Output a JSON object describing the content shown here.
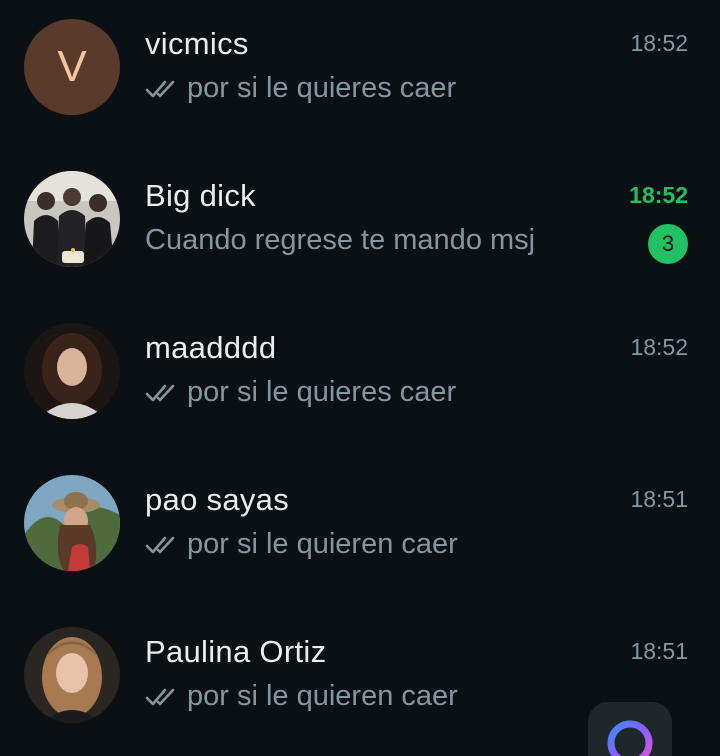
{
  "chats": [
    {
      "name": "vicmics",
      "time": "18:52",
      "preview": "por si le quieres caer",
      "avatar_letter": "V",
      "read_receipt": "double-check-icon"
    },
    {
      "name": "Big dick",
      "time": "18:52",
      "preview": "Cuando regrese te mando msj",
      "unread_count": "3"
    },
    {
      "name": "maadddd",
      "time": "18:52",
      "preview": "por si le quieres caer",
      "read_receipt": "double-check-icon"
    },
    {
      "name": "pao sayas",
      "time": "18:51",
      "preview": "por si le quieren caer",
      "read_receipt": "double-check-icon"
    },
    {
      "name": "Paulina Ortiz",
      "time": "18:51",
      "preview": "por si le quieren caer",
      "read_receipt": "double-check-icon"
    }
  ],
  "colors": {
    "background": "#0b1014",
    "name_text": "#e9edef",
    "secondary_text": "#8696a0",
    "unread_accent": "#21c063"
  },
  "fab": {
    "icon": "meta-ai-ring-icon"
  }
}
